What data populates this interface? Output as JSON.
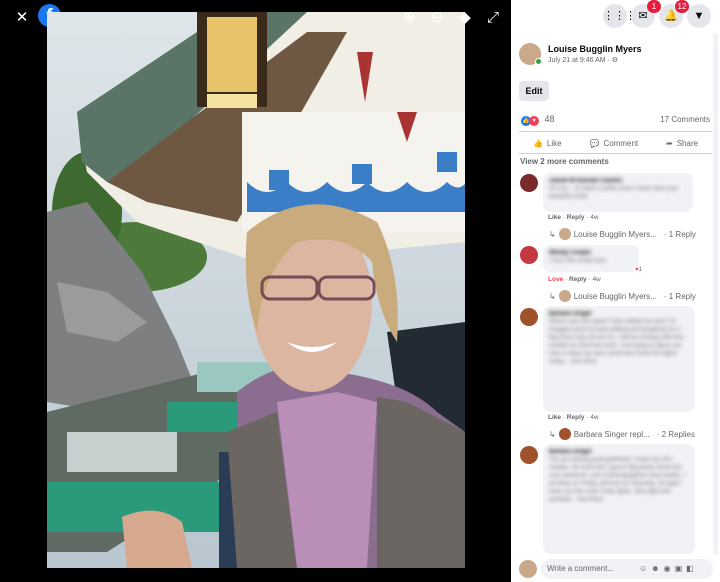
{
  "viewer": {
    "close_icon": "close-icon",
    "logo_text": "f",
    "tools": [
      "zoom-in-icon",
      "zoom-out-icon",
      "tag-icon",
      "fullscreen-icon"
    ]
  },
  "navbar": {
    "messenger_badge": "1",
    "notifications_badge": "12"
  },
  "post": {
    "author": "Louise Bugglin Myers",
    "timestamp": "July 21 at 9:46 AM · ",
    "edit_label": "Edit",
    "reaction_count": "48",
    "comment_count": "17 Comments",
    "like_label": "Like",
    "comment_label": "Comment",
    "share_label": "Share",
    "view_more": "View 2 more comments"
  },
  "comments": [
    {
      "author": "Joanie M Karman Charles",
      "text": "Hi Lulu... it's been a while since I have seen your beautiful smile.",
      "like": "Like",
      "reply": "Reply",
      "age": "4w",
      "reply_author": "Louise Bugglin Myers...",
      "reply_count": "· 1 Reply"
    },
    {
      "author": "Wendy Cooper",
      "text": "I miss this lovely face",
      "like": "Love",
      "reply": "Reply",
      "age": "4w",
      "reaction_count": "1",
      "reply_author": "Louise Bugglin Myers...",
      "reply_count": "· 1 Reply"
    },
    {
      "author": "Barbara Singer",
      "text": "Where was this taken? How settled are you? I'd bragged down to book editing and preparing for a big shoot July 29 and 31. I will be working with four models for and hour each. Just trying to figure out how to keep my new Lumecube Panel Pro lights sharp... See More",
      "like": "Like",
      "reply": "Reply",
      "age": "4w",
      "reply_author": "Barbara Singer repl...",
      "reply_count": "· 2 Replies"
    },
    {
      "author": "Barbara Singer",
      "text": "You are looking good girlfriend. I have two 2D+ models. No more but I guess! Big photo shoot this next weekend. Lots of photographers and models. I do three on Friday and one on Saturday. So glad I have my new color Cube lights. Very light and portable... See More"
    }
  ],
  "composer": {
    "placeholder": "Write a comment..."
  },
  "colors": {
    "accent": "#1877f2",
    "badge": "#e41e3f",
    "love": "#f33e58"
  }
}
